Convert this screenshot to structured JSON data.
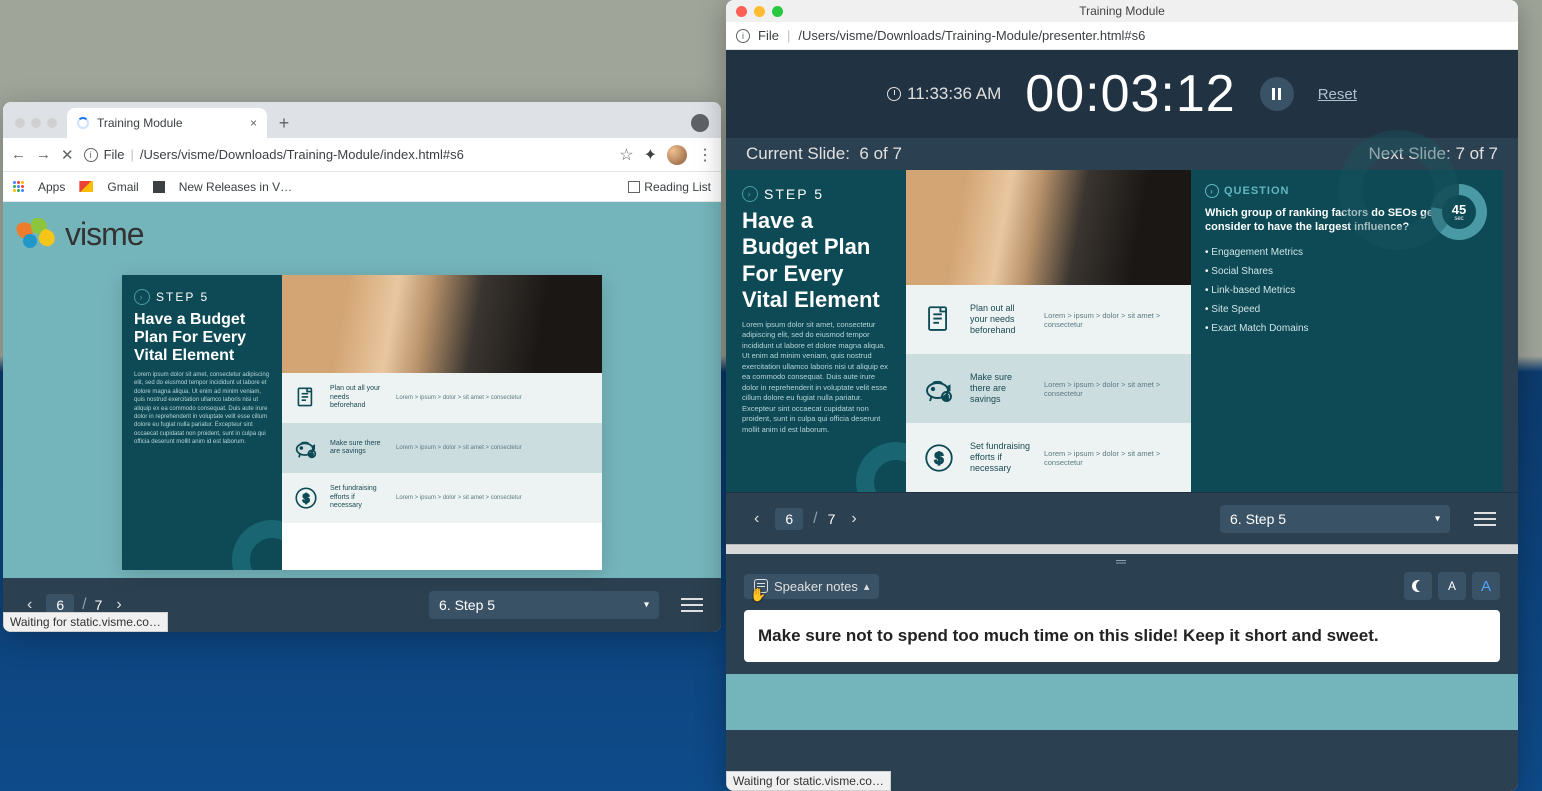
{
  "browser": {
    "tab_title": "Training Module",
    "new_tab": "+",
    "url_scheme": "File",
    "url_path": "/Users/visme/Downloads/Training-Module/index.html#s6",
    "bookmarks": {
      "apps": "Apps",
      "gmail": "Gmail",
      "new_rel": "New Releases in V…",
      "reading": "Reading List"
    },
    "status": "Waiting for static.visme.co…"
  },
  "logo_text": "visme",
  "slide": {
    "step_label": "STEP 5",
    "title": "Have a Budget Plan For Every Vital Element",
    "lorem": "Lorem ipsum dolor sit amet, consectetur adipiscing elit, sed do eiusmod tempor incididunt ut labore et dolore magna aliqua. Ut enim ad minim veniam, quis nostrud exercitation ullamco laboris nisi ut aliquip ex ea commodo consequat. Duis aute irure dolor in reprehenderit in voluptate velit esse cillum dolore eu fugiat nulla pariatur. Excepteur sint occaecat cupidatat non proident, sunt in culpa qui officia deserunt mollit anim id est laborum.",
    "rows": [
      {
        "t": "Plan out all your needs beforehand",
        "m": "Lorem > ipsum > dolor > sit amet > consectetur"
      },
      {
        "t": "Make sure there are savings",
        "m": "Lorem > ipsum > dolor > sit amet > consectetur"
      },
      {
        "t": "Set fundraising efforts if necessary",
        "m": "Lorem > ipsum > dolor > sit amet > consectetur"
      }
    ]
  },
  "nav": {
    "cur": "6",
    "total": "7",
    "select": "6. Step 5"
  },
  "presenter": {
    "win_title": "Training Module",
    "url_scheme": "File",
    "url_path": "/Users/visme/Downloads/Training-Module/presenter.html#s6",
    "clock": "11:33:36 AM",
    "elapsed": "00:03:12",
    "reset": "Reset",
    "current_label": "Current Slide:",
    "current_num": "6 of 7",
    "next_label": "Next Slide:",
    "next_num": "7 of 7",
    "question": {
      "label": "QUESTION",
      "title": "Which group of ranking factors do SEOs generally consider to have the largest influence?",
      "items": [
        "Engagement Metrics",
        "Social Shares",
        "Link-based Metrics",
        "Site Speed",
        "Exact Match Domains"
      ],
      "donut_val": "45",
      "donut_unit": "sec"
    },
    "speaker_label": "Speaker notes",
    "note": "Make sure not to spend too much time on this slide! Keep it short and sweet.",
    "status": "Waiting for static.visme.co…"
  }
}
